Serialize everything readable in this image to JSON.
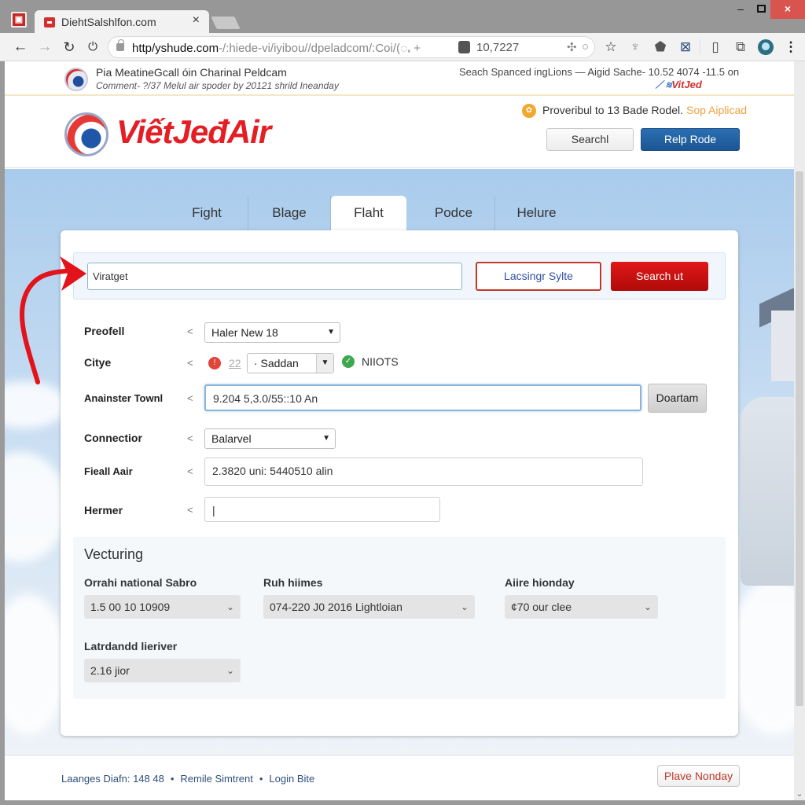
{
  "browser": {
    "tab_title": "DiehtSalshlfon.com",
    "tab_close": "×",
    "url_host": "http/yshude.com",
    "url_path": "-/:hiede-vi/iyibou//dpeladcom/:Coi/(ႇ +",
    "address_number": "10,7227",
    "window_controls": {
      "minimize": "–",
      "close": "×"
    }
  },
  "notice": {
    "title": "Pia MeatineGcall óin Charinal Peldcam",
    "subtitle": "Comment- ?/37 Melul air spoder by 20121 shrild Ineanday",
    "right_text": "Seach Spanced ingLions — Aigid Sache- 10.52 4074 -11.5 on",
    "brand": "VitJed"
  },
  "header": {
    "logo_text": "ViếtJeđAir",
    "promo_text": "Proveribul to 13 Bade Rodel.",
    "promo_link": "Sop Aiplicad",
    "search_button": "Searchl",
    "help_button": "Relp Rode"
  },
  "tabs": [
    {
      "label": "Fight",
      "active": false
    },
    {
      "label": "Blage",
      "active": false
    },
    {
      "label": "Flaht",
      "active": true
    },
    {
      "label": "Podce",
      "active": false
    },
    {
      "label": "Helure",
      "active": false
    }
  ],
  "search_strip": {
    "input_value": "Viratget",
    "outline_button": "Lacsingr Sylte",
    "search_button": "Search ut"
  },
  "form": {
    "chevron": "<",
    "rows": [
      {
        "label": "Preofell",
        "value": "Haler New 18"
      },
      {
        "label": "Citye",
        "count": "22",
        "value": "· Saddan",
        "status": "NIIOTS"
      },
      {
        "label": "Anainster Townl",
        "value": "9.204 5,3.0/55::10 An",
        "button": "Doartam"
      },
      {
        "label": "Connectior",
        "value": "Balarvel"
      },
      {
        "label": "Fieall Aair",
        "value": "2.3820 uni: 5440510 alin"
      },
      {
        "label": "Hermer",
        "value": "|"
      }
    ]
  },
  "section": {
    "title": "Vecturing",
    "fields": [
      {
        "label": "Orrahi national Sabro",
        "value": "1.5 00 10 10909"
      },
      {
        "label": "Ruh hiimes",
        "value": "074-220 J0 2016 Lightloian"
      },
      {
        "label": "Aiire hionday",
        "value": "¢70 our clee"
      },
      {
        "label": "Latrdandd lieriver",
        "value": "2.16 jior"
      }
    ]
  },
  "footer": {
    "links": [
      "Laanges Diafn: 148 48",
      "Remile Simtrent",
      "Login Bite"
    ],
    "separator": "•",
    "button": "Plave Nonday"
  },
  "colors": {
    "brand_red": "#e31e24",
    "primary_blue": "#1c5592",
    "accent_orange": "#f0a040"
  }
}
